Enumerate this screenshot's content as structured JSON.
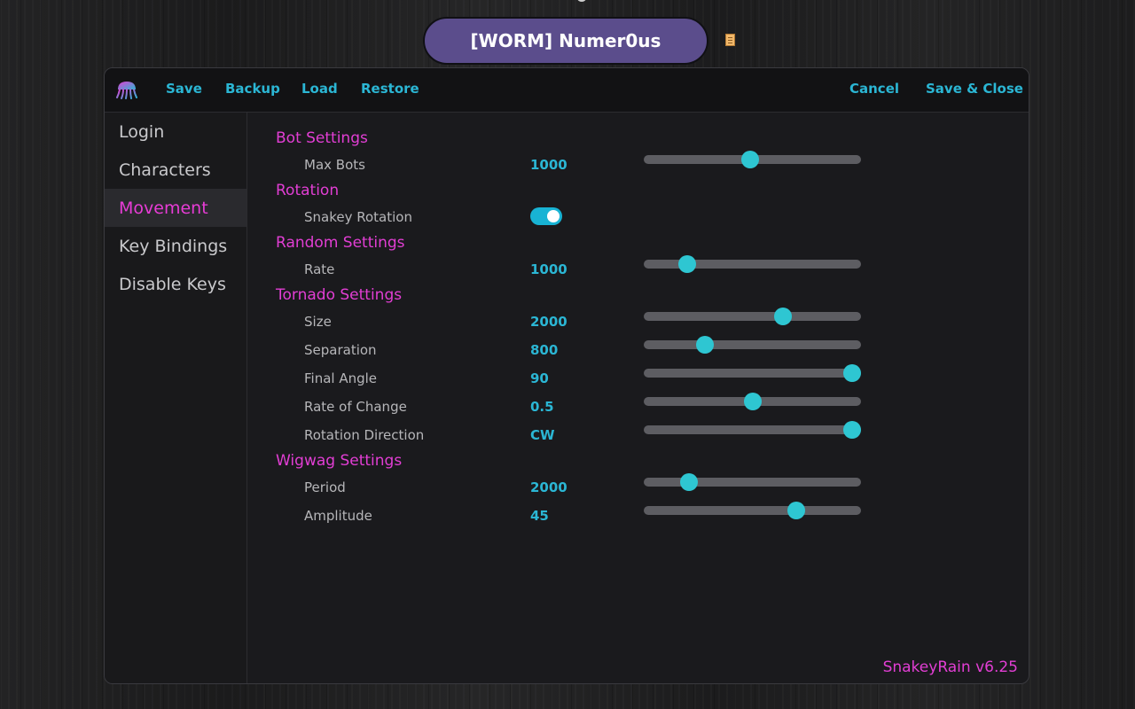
{
  "player": {
    "name": "[WORM] Numer0us",
    "note_icon": "note-icon"
  },
  "toolbar": {
    "logo_icon": "jellyfish-icon",
    "save": "Save",
    "backup": "Backup",
    "load": "Load",
    "restore": "Restore",
    "cancel": "Cancel",
    "save_close": "Save & Close"
  },
  "sidebar": {
    "items": [
      {
        "label": "Login",
        "active": false
      },
      {
        "label": "Characters",
        "active": false
      },
      {
        "label": "Movement",
        "active": true
      },
      {
        "label": "Key Bindings",
        "active": false
      },
      {
        "label": "Disable Keys",
        "active": false
      }
    ]
  },
  "settings": {
    "bot": {
      "title": "Bot Settings",
      "max_bots": {
        "label": "Max Bots",
        "value": "1000",
        "level": 0.49
      }
    },
    "rotation": {
      "title": "Rotation",
      "snakey_rotation": {
        "label": "Snakey Rotation",
        "enabled": true
      }
    },
    "random": {
      "title": "Random Settings",
      "rate": {
        "label": "Rate",
        "value": "1000",
        "level": 0.2
      }
    },
    "tornado": {
      "title": "Tornado Settings",
      "size": {
        "label": "Size",
        "value": "2000",
        "level": 0.64
      },
      "separation": {
        "label": "Separation",
        "value": "800",
        "level": 0.28
      },
      "final_angle": {
        "label": "Final Angle",
        "value": "90",
        "level": 0.96
      },
      "rate_of_change": {
        "label": "Rate of Change",
        "value": "0.5",
        "level": 0.5
      },
      "rotation_direction": {
        "label": "Rotation Direction",
        "value": "CW",
        "level": 0.96
      }
    },
    "wigwag": {
      "title": "Wigwag Settings",
      "period": {
        "label": "Period",
        "value": "2000",
        "level": 0.21
      },
      "amplitude": {
        "label": "Amplitude",
        "value": "45",
        "level": 0.7
      }
    }
  },
  "version": "SnakeyRain v6.25",
  "colors": {
    "accent_pink": "#e23ed4",
    "accent_cyan": "#2bb6d4",
    "pill_purple": "#5b4d8c"
  }
}
